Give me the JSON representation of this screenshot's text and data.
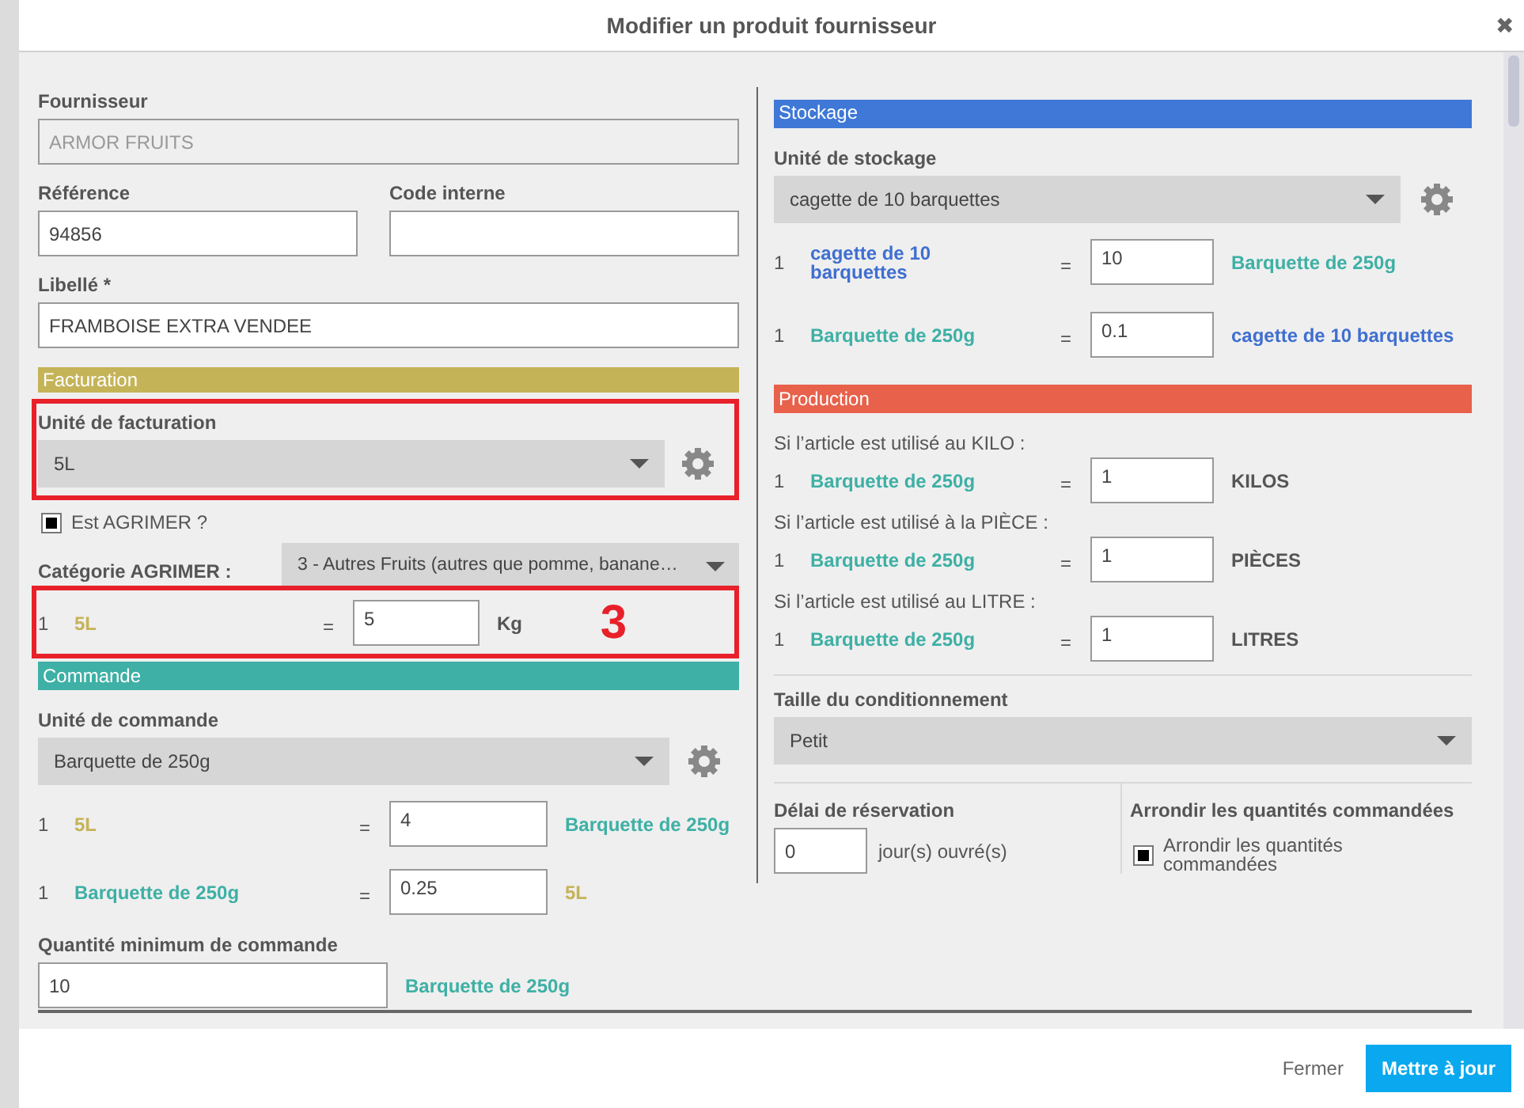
{
  "dialog": {
    "title": "Modifier un produit fournisseur",
    "close": "✖"
  },
  "supplier": {
    "label": "Fournisseur",
    "value": "ARMOR FRUITS",
    "disabled": true
  },
  "reference": {
    "label": "Référence",
    "value": "94856"
  },
  "internal_code": {
    "label": "Code interne"
  },
  "product_name": {
    "label": "Libellé *",
    "value": "FRAMBOISE EXTRA VENDEE"
  },
  "billing": {
    "header": "Facturation",
    "color": "#c5b358",
    "unit": {
      "label": "Unité de facturation",
      "value": "5L",
      "highlighted": true
    },
    "agrimer": {
      "label": "Est AGRIMER ?",
      "checked": true
    },
    "agrimer_category": {
      "label": "Catégorie AGRIMER :",
      "value": "3 - Autres Fruits (autres que pomme, banane…"
    },
    "conversion": {
      "highlighted": true,
      "annotation": "3",
      "qty": "1",
      "from": {
        "text": "5L",
        "color": "#c5b358"
      },
      "op": "=",
      "value": "5",
      "to": {
        "text": "Kg"
      }
    }
  },
  "order": {
    "header": "Commande",
    "color": "#3eb0a5",
    "unit": {
      "label": "Unité de commande",
      "value": "Barquette de 250g"
    },
    "conversions": [
      {
        "qty": "1",
        "from": {
          "text": "5L",
          "color": "#c5b358"
        },
        "op": "=",
        "value": "4",
        "to": {
          "text": "Barquette de 250g",
          "color": "#3eb0a5"
        }
      },
      {
        "qty": "1",
        "from": {
          "text": "Barquette de 250g",
          "color": "#3eb0a5"
        },
        "op": "=",
        "value": "0.25",
        "to": {
          "text": "5L",
          "color": "#c5b358"
        }
      }
    ],
    "minimum": {
      "label": "Quantité minimum de commande",
      "value": "10",
      "unit": {
        "text": "Barquette de 250g",
        "color": "#3eb0a5"
      }
    }
  },
  "storage": {
    "header": "Stockage",
    "color": "#3f78d6",
    "unit": {
      "label": "Unité de stockage",
      "value": "cagette de 10 barquettes"
    },
    "conversions": [
      {
        "qty": "1",
        "from": {
          "text": "cagette de 10 barquettes",
          "color": "#3f6fd0"
        },
        "op": "=",
        "value": "10",
        "to": {
          "text": "Barquette de 250g",
          "color": "#3eb0a5"
        }
      },
      {
        "qty": "1",
        "from": {
          "text": "Barquette de 250g",
          "color": "#3eb0a5"
        },
        "op": "=",
        "value": "0.1",
        "to": {
          "text": "cagette de 10 barquettes",
          "color": "#3f6fd0"
        }
      }
    ]
  },
  "production": {
    "header": "Production",
    "color": "#e8614b",
    "items": [
      {
        "caption": "Si l’article est utilisé au KILO :",
        "qty": "1",
        "from": {
          "text": "Barquette de 250g",
          "color": "#3eb0a5"
        },
        "op": "=",
        "value": "1",
        "to": {
          "text": "KILOS"
        }
      },
      {
        "caption": "Si l’article est utilisé à la PIÈCE :",
        "qty": "1",
        "from": {
          "text": "Barquette de 250g",
          "color": "#3eb0a5"
        },
        "op": "=",
        "value": "1",
        "to": {
          "text": "PIÈCES"
        }
      },
      {
        "caption": "Si l’article est utilisé au LITRE :",
        "qty": "1",
        "from": {
          "text": "Barquette de 250g",
          "color": "#3eb0a5"
        },
        "op": "=",
        "value": "1",
        "to": {
          "text": "LITRES"
        }
      }
    ]
  },
  "package_size": {
    "label": "Taille du conditionnement",
    "value": "Petit"
  },
  "reservation": {
    "label": "Délai de réservation",
    "value": "0",
    "unit": "jour(s) ouvré(s)"
  },
  "rounding": {
    "label": "Arrondir les quantités commandées",
    "checkbox_label": "Arrondir les quantités commandées",
    "checked": true
  },
  "footer": {
    "close": "Fermer",
    "submit": "Mettre à jour"
  }
}
